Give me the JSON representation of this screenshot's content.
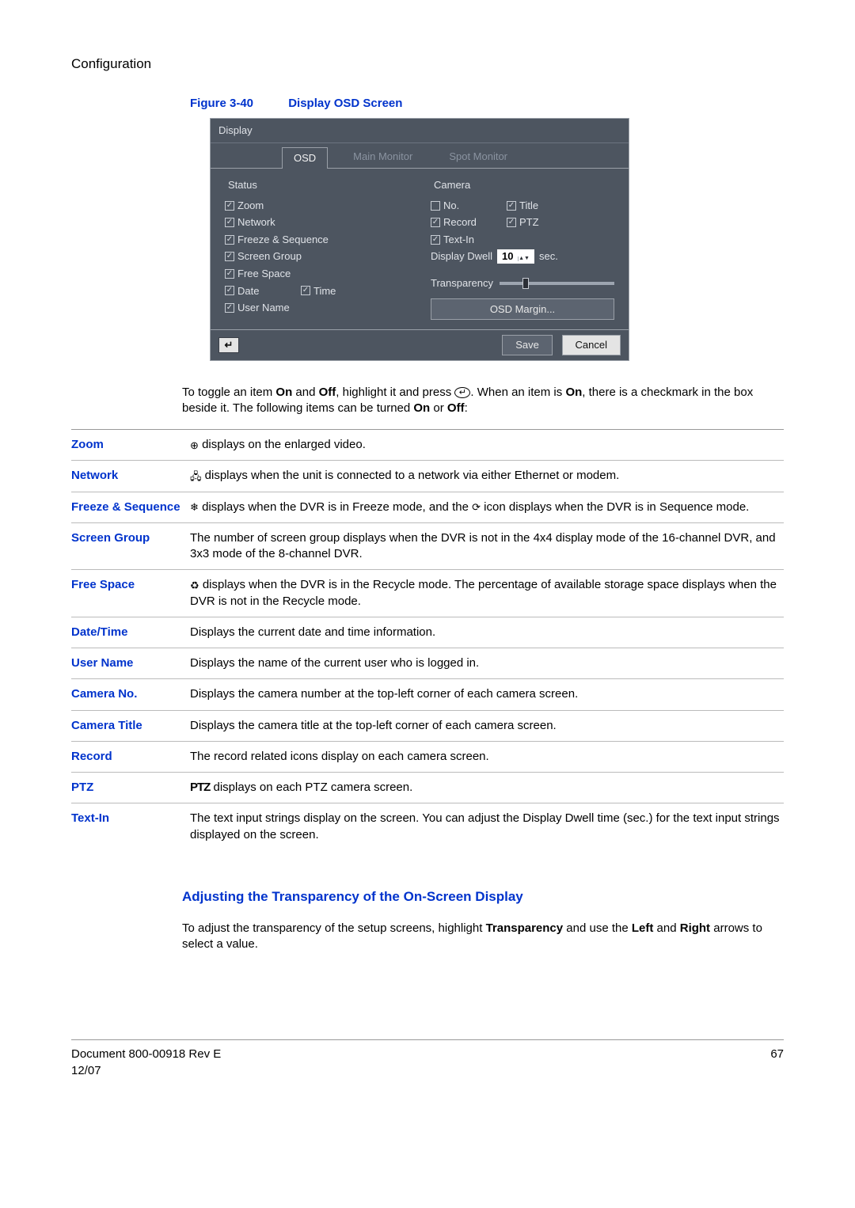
{
  "section": "Configuration",
  "figure": {
    "num": "Figure 3-40",
    "title": "Display OSD Screen"
  },
  "osd": {
    "panel_title": "Display",
    "tabs": {
      "osd": "OSD",
      "main": "Main Monitor",
      "spot": "Spot Monitor"
    },
    "status": {
      "heading": "Status",
      "zoom": "Zoom",
      "network": "Network",
      "freeze": "Freeze & Sequence",
      "screen_group": "Screen Group",
      "free_space": "Free Space",
      "date": "Date",
      "time": "Time",
      "user_name": "User Name"
    },
    "camera": {
      "heading": "Camera",
      "no": "No.",
      "title": "Title",
      "record": "Record",
      "ptz": "PTZ",
      "textin": "Text-In",
      "dwell_label": "Display Dwell",
      "dwell_value": "10",
      "dwell_unit": "sec."
    },
    "transparency_label": "Transparency",
    "margin_btn": "OSD Margin...",
    "save": "Save",
    "cancel": "Cancel"
  },
  "para_before_table": {
    "p1a": "To toggle an item ",
    "on": "On",
    "p1b": " and ",
    "off": "Off",
    "p1c": ", highlight it and press ",
    "p1d": ". When an item is ",
    "p1e": ", there is a checkmark in the box beside it. The following items can be turned ",
    "p1f": " or ",
    "p1g": ":"
  },
  "rows": {
    "zoom_l": "Zoom",
    "zoom_d": " displays on the enlarged video.",
    "network_l": "Network",
    "network_d": " displays when the unit is connected to a network via either Ethernet or modem.",
    "freeze_l": "Freeze & Sequence",
    "freeze_d1": " displays when the DVR is in Freeze mode, and the ",
    "freeze_d2": " icon displays when the DVR is in Sequence mode.",
    "screen_l": "Screen Group",
    "screen_d": "The number of screen group displays when the DVR is not in the 4x4 display mode of the 16-channel DVR, and 3x3 mode of the 8-channel DVR.",
    "free_l": "Free Space",
    "free_d": " displays when the DVR is in the Recycle mode. The percentage of available storage space displays when the DVR is not in the Recycle mode.",
    "date_l": "Date/Time",
    "date_d": "Displays the current date and time information.",
    "user_l": "User Name",
    "user_d": "Displays the name of the current user who is logged in.",
    "camno_l": "Camera No.",
    "camno_d": "Displays the camera number at the top-left corner of each camera screen.",
    "camtitle_l": "Camera Title",
    "camtitle_d": "Displays the camera title at the top-left corner of each camera screen.",
    "record_l": "Record",
    "record_d": "The record related icons display on each camera screen.",
    "ptz_l": "PTZ",
    "ptz_d": " displays on each PTZ camera screen.",
    "textin_l": "Text-In",
    "textin_d": "The text input strings display on the screen. You can adjust the Display Dwell time (sec.) for the text input strings displayed on the screen."
  },
  "subsection": "Adjusting the Transparency of the On-Screen Display",
  "transp_para": {
    "a": "To adjust the transparency of the setup screens, highlight ",
    "b": "Transparency",
    "c": " and use the ",
    "d": "Left",
    "e": " and ",
    "f": "Right",
    "g": " arrows to select a value."
  },
  "footer": {
    "doc": "Document 800-00918 Rev E",
    "date": "12/07",
    "page": "67"
  }
}
